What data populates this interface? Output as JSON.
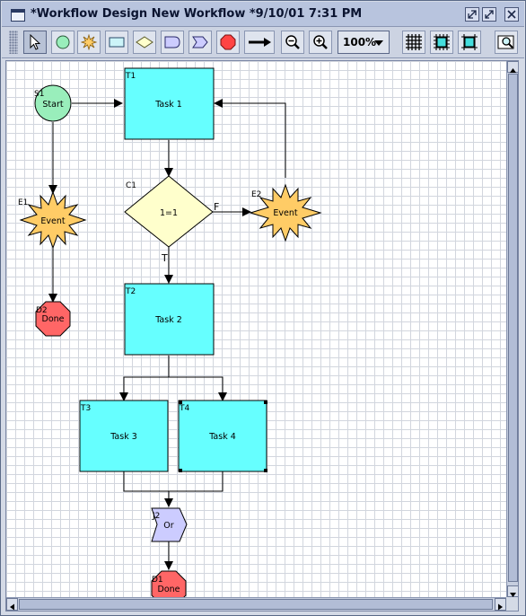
{
  "window": {
    "title": "*Workflow Design New Workflow  *9/10/01 7:31 PM",
    "buttons": [
      "restore-icon",
      "maximize-icon",
      "close-icon"
    ]
  },
  "toolbar": {
    "tools": [
      {
        "name": "select-tool",
        "icon": "pointer-icon",
        "active": true
      },
      {
        "name": "start-node-tool",
        "icon": "circle-icon"
      },
      {
        "name": "event-node-tool",
        "icon": "starburst-icon"
      },
      {
        "name": "task-node-tool",
        "icon": "rectangle-icon"
      },
      {
        "name": "condition-node-tool",
        "icon": "diamond-icon"
      },
      {
        "name": "subflow-node-tool",
        "icon": "rounded-tab-icon"
      },
      {
        "name": "join-node-tool",
        "icon": "chevron-shape-icon"
      },
      {
        "name": "stop-node-tool",
        "icon": "octagon-icon"
      },
      {
        "name": "connector-tool",
        "icon": "arrow-icon"
      }
    ],
    "zoom_out": "zoom-out-icon",
    "zoom_in": "zoom-in-icon",
    "zoom_value": "100%",
    "grid_buttons": [
      "grid-icon",
      "snap-grid-icon",
      "align-grid-icon"
    ],
    "overview_button": "overview-icon"
  },
  "diagram": {
    "nodes": [
      {
        "id": "S1",
        "tag": "S1",
        "label": "Start",
        "kind": "start"
      },
      {
        "id": "T1",
        "tag": "T1",
        "label": "Task 1",
        "kind": "task"
      },
      {
        "id": "E1",
        "tag": "E1",
        "label": "Event",
        "kind": "event"
      },
      {
        "id": "C1",
        "tag": "C1",
        "label": "1=1",
        "kind": "condition"
      },
      {
        "id": "E2",
        "tag": "E2",
        "label": "Event",
        "kind": "event"
      },
      {
        "id": "D2",
        "tag": "D2",
        "label": "Done",
        "kind": "done"
      },
      {
        "id": "T2",
        "tag": "T2",
        "label": "Task 2",
        "kind": "task"
      },
      {
        "id": "T3",
        "tag": "T3",
        "label": "Task 3",
        "kind": "task"
      },
      {
        "id": "T4",
        "tag": "T4",
        "label": "Task 4",
        "kind": "task",
        "selected": true
      },
      {
        "id": "J2",
        "tag": "J2",
        "label": "Or",
        "kind": "join"
      },
      {
        "id": "D1",
        "tag": "D1",
        "label": "Done",
        "kind": "done"
      }
    ],
    "edge_labels": {
      "false_branch": "F",
      "true_branch": "T"
    }
  },
  "colors": {
    "task": "#66ffff",
    "start": "#99eebb",
    "event": "#ffcc66",
    "condition": "#ffffcc",
    "done": "#ff6666",
    "join": "#ccccff"
  }
}
